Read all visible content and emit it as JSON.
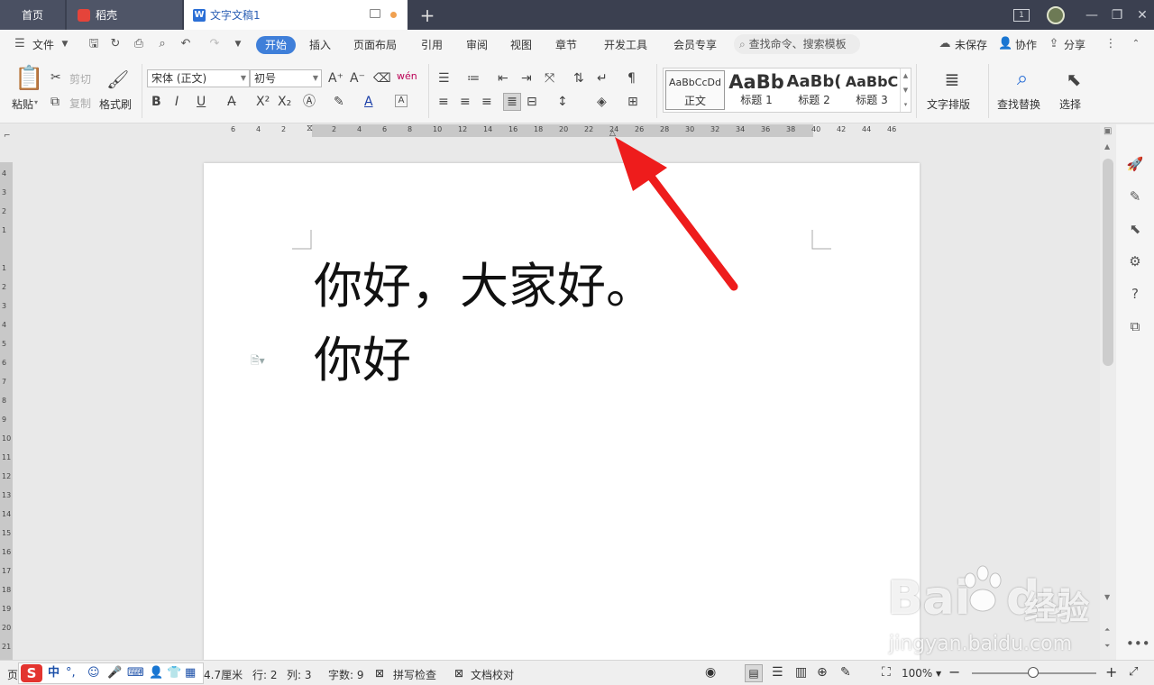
{
  "tabs": {
    "home": "首页",
    "daoke": "稻壳",
    "doc": "文字文稿1",
    "add": "+"
  },
  "window": {
    "page_badge": "1"
  },
  "menu": {
    "file": "文件",
    "items": [
      "开始",
      "插入",
      "页面布局",
      "引用",
      "审阅",
      "视图",
      "章节",
      "开发工具",
      "会员专享"
    ],
    "search_placeholder": "查找命令、搜索模板",
    "unsaved": "未保存",
    "collab": "协作",
    "share": "分享"
  },
  "ribbon": {
    "paste": "粘贴",
    "cut": "剪切",
    "copy": "复制",
    "format_painter": "格式刷",
    "font_name": "宋体 (正文)",
    "font_size": "初号",
    "styles": [
      {
        "sample": "AaBbCcDd",
        "label": "正文"
      },
      {
        "sample": "AaBb",
        "label": "标题 1"
      },
      {
        "sample": "AaBb(",
        "label": "标题 2"
      },
      {
        "sample": "AaBbC",
        "label": "标题 3"
      }
    ],
    "text_layout": "文字排版",
    "find_replace": "查找替换",
    "select": "选择"
  },
  "ruler": {
    "h_ticks": [
      "6",
      "4",
      "2",
      "",
      "2",
      "4",
      "6",
      "8",
      "10",
      "12",
      "14",
      "16",
      "18",
      "20",
      "22",
      "24",
      "26",
      "28",
      "30",
      "32",
      "34",
      "36",
      "38",
      "40",
      "42",
      "44",
      "46"
    ],
    "v_ticks": [
      "4",
      "3",
      "2",
      "1",
      "",
      "1",
      "2",
      "3",
      "4",
      "5",
      "6",
      "7",
      "8",
      "9",
      "10",
      "11",
      "12",
      "13",
      "14",
      "15",
      "16",
      "17",
      "18",
      "19",
      "20",
      "21"
    ]
  },
  "document": {
    "lines": [
      "你好，大家好。",
      "你好"
    ]
  },
  "watermark": {
    "brand": "Bai",
    "brand2": "du",
    "jingyan": "经验",
    "url": "jingyan.baidu.com"
  },
  "status": {
    "page_prefix": "页",
    "position": "4.7厘米",
    "row": "行: 2",
    "col": "列: 3",
    "words": "字数: 9",
    "spell": "拼写检查",
    "proof": "文档校对",
    "zoom": "100%",
    "ime_lang": "中"
  },
  "colors": {
    "accent": "#3f7fd9",
    "titlebar": "#3b4050",
    "arrow": "#ee1c1c"
  }
}
